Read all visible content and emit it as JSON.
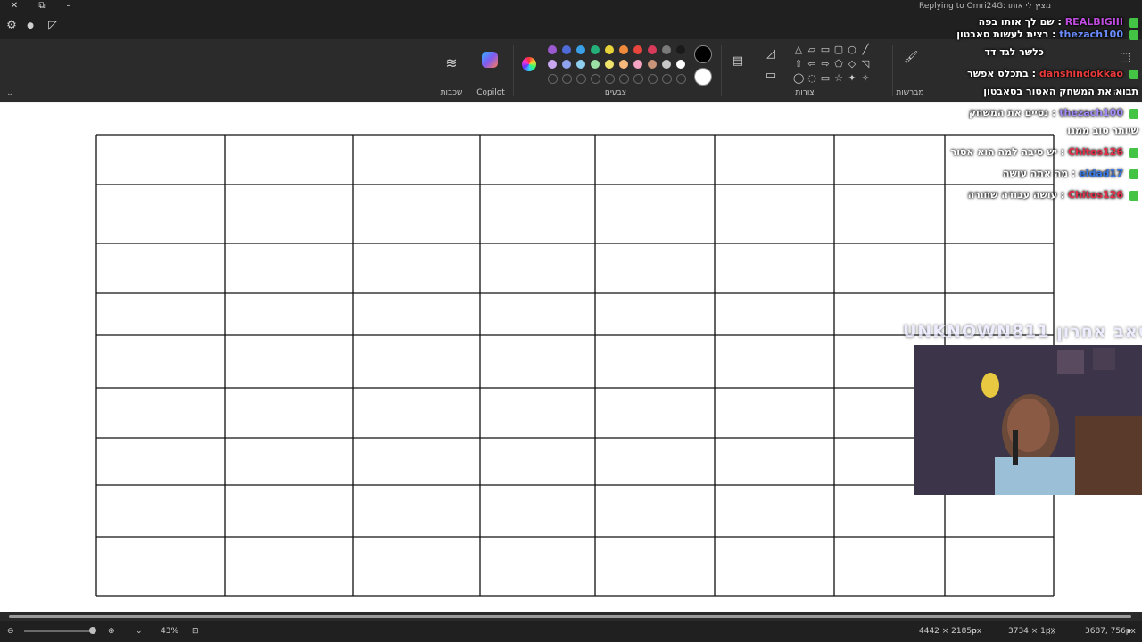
{
  "window": {
    "controls": {
      "close": "✕",
      "restore": "⧉",
      "minimize": "–"
    }
  },
  "toolbar": {
    "icons": [
      "gear-icon",
      "alert-icon",
      "megaphone-icon"
    ]
  },
  "ribbon": {
    "groups": {
      "layers": "שכבות",
      "copilot": "Copilot",
      "colors": "צבעים",
      "shapes": "צורות",
      "brushes": "מברשות",
      "selection": "בחירה"
    },
    "colors": {
      "row1": [
        "#9b59d0",
        "#4f6bd8",
        "#3aa0e8",
        "#25b07a",
        "#e8d23a",
        "#f08a3c",
        "#e8453c",
        "#d83a5a",
        "#7a7a7a",
        "#1a1a1a"
      ],
      "row2": [
        "#c9a8f0",
        "#8fa3ee",
        "#8fd0f0",
        "#9ce0a5",
        "#f0e46c",
        "#f5b97c",
        "#f5a3c0",
        "#c9957a",
        "#c8c8c8",
        "#ffffff"
      ],
      "primary": "#000000",
      "secondary": "#ffffff"
    }
  },
  "canvas": {
    "columns": 8,
    "rows": 9
  },
  "status": {
    "zoom": "43%",
    "canvas_size": "4442 × 2185px",
    "selection_size": "3734 × 1px",
    "cursor_position": "3687, 756px"
  },
  "chat": {
    "reply_header": "Replying to Omri24G: מציץ לי אותו",
    "messages": [
      {
        "user": "REALBIGIII",
        "text": "שם לך אותו בפה",
        "color": "#c04ce0"
      },
      {
        "user": "thezach100",
        "text": "רצית לעשות סאבטון",
        "color": "#6b8cff"
      },
      {
        "user": "danshindokkao",
        "text": "בתכלס אפשר",
        "color": "#e83a3a"
      },
      {
        "user": "",
        "text": "תבוא את המשחק האסור בסאבטון",
        "color": "#ffffff"
      },
      {
        "user": "thezach100",
        "text": "נסיים את המשחק",
        "color": "#a58cff"
      },
      {
        "user": "",
        "text": "שיותר טוב ממנו",
        "color": "#ffffff"
      },
      {
        "user": "Chitos126",
        "text": "יש סיבה למה הוא אסור",
        "color": "#e8304a"
      },
      {
        "user": "eldad17",
        "text": "מה אתה עושה",
        "color": "#3a7ae8"
      },
      {
        "user": "Chitos126",
        "text": "עושה עבודה שחורה",
        "color": "#e8304a"
      }
    ],
    "pinned": "כלשר לגד דד"
  },
  "overlay": {
    "last_sub_label": "סאב אחרון",
    "last_sub_user": "UNKNOWN811"
  }
}
